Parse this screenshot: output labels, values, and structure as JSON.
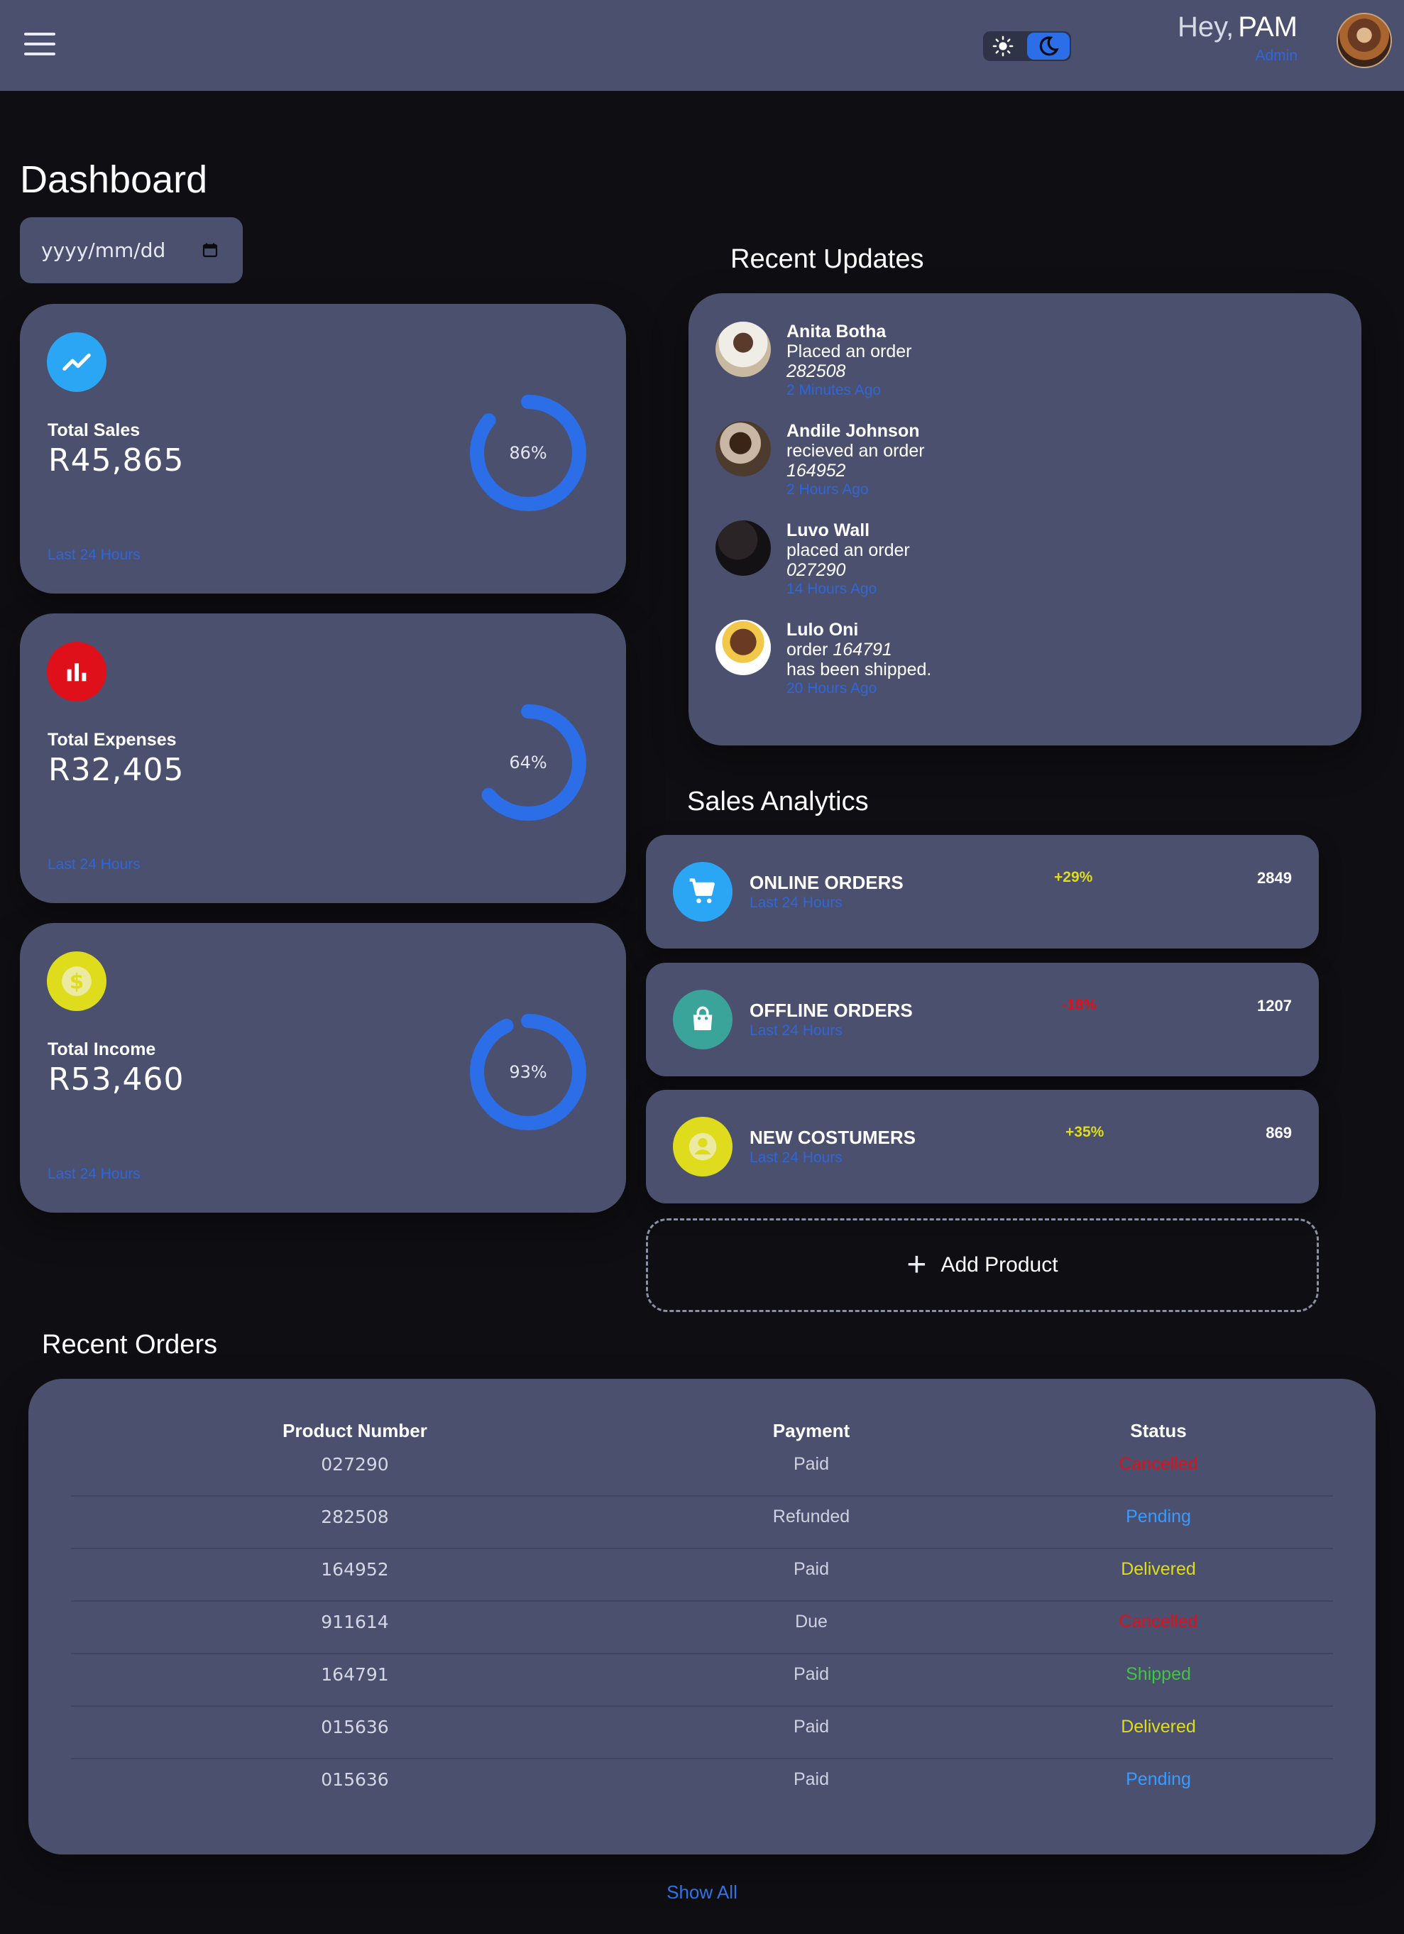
{
  "header": {
    "greeting": "Hey,",
    "user_name": "PAM",
    "user_role": "Admin",
    "menu_icon": "menu-icon",
    "theme_light_icon": "sun-icon",
    "theme_dark_icon": "moon-icon",
    "theme_mode": "dark"
  },
  "page": {
    "title": "Dashboard",
    "date_placeholder": "yyyy/mm/dd"
  },
  "stats": [
    {
      "label": "Total Sales",
      "value": "R45,865",
      "percent_label": "86%",
      "percent": 0.86,
      "period": "Last 24 Hours",
      "icon": "trend-up-icon",
      "icon_color": "#2aa6f5"
    },
    {
      "label": "Total Expenses",
      "value": "R32,405",
      "percent_label": "64%",
      "percent": 0.64,
      "period": "Last 24 Hours",
      "icon": "bar-chart-icon",
      "icon_color": "#e0101a"
    },
    {
      "label": "Total Income",
      "value": "R53,460",
      "percent_label": "93%",
      "percent": 0.93,
      "period": "Last 24 Hours",
      "icon": "dollar-icon",
      "icon_color": "#dedc1c"
    }
  ],
  "recent_updates": {
    "title": "Recent Updates",
    "items": [
      {
        "name": "Anita Botha",
        "line1": "Placed an order",
        "order": "282508",
        "time": "2 Minutes Ago"
      },
      {
        "name": "Andile Johnson",
        "line1": "recieved an order",
        "order": "164952",
        "time": "2 Hours Ago"
      },
      {
        "name": "Luvo Wall",
        "line1": "placed an order",
        "order": "027290",
        "time": "14 Hours Ago"
      },
      {
        "name": "Lulo Oni",
        "line1": "order",
        "order": "164791",
        "line2": "has been shipped.",
        "time": "20 Hours Ago"
      }
    ]
  },
  "sales_analytics": {
    "title": "Sales Analytics",
    "items": [
      {
        "title": "ONLINE ORDERS",
        "period": "Last 24 Hours",
        "change": "+29%",
        "count": "2849",
        "icon": "cart-icon",
        "icon_color": "#2aa6f5",
        "change_color": "#dedc1c"
      },
      {
        "title": "OFFLINE ORDERS",
        "period": "Last 24 Hours",
        "change": "-18%",
        "count": "1207",
        "icon": "shopping-bag-icon",
        "icon_color": "#3aa39a",
        "change_color": "#e0101a"
      },
      {
        "title": "NEW COSTUMERS",
        "period": "Last 24 Hours",
        "change": "+35%",
        "count": "869",
        "icon": "user-icon",
        "icon_color": "#dedc1c",
        "change_color": "#dedc1c"
      }
    ],
    "add_product": "Add Product"
  },
  "recent_orders": {
    "title": "Recent Orders",
    "columns": [
      "Product Number",
      "Payment",
      "Status"
    ],
    "rows": [
      {
        "product": "027290",
        "payment": "Paid",
        "status": "Cancelled",
        "status_color": "#e0101a"
      },
      {
        "product": "282508",
        "payment": "Refunded",
        "status": "Pending",
        "status_color": "#3a9bff"
      },
      {
        "product": "164952",
        "payment": "Paid",
        "status": "Delivered",
        "status_color": "#dedc1c"
      },
      {
        "product": "911614",
        "payment": "Due",
        "status": "Cancelled",
        "status_color": "#e0101a"
      },
      {
        "product": "164791",
        "payment": "Paid",
        "status": "Shipped",
        "status_color": "#41c542"
      },
      {
        "product": "015636",
        "payment": "Paid",
        "status": "Delivered",
        "status_color": "#dedc1c"
      },
      {
        "product": "015636",
        "payment": "Paid",
        "status": "Pending",
        "status_color": "#3a9bff"
      }
    ],
    "show_all": "Show All"
  }
}
